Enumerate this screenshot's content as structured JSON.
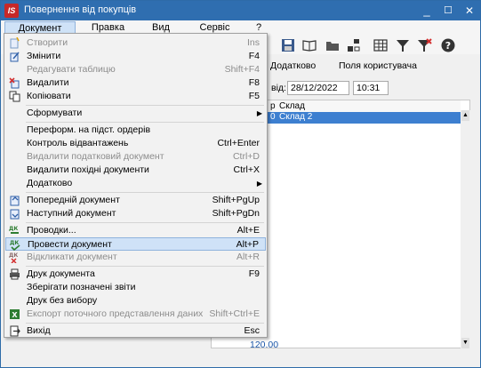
{
  "window": {
    "title": "Повернення від покупців"
  },
  "titlebar": {
    "minimize": "_",
    "maximize": "☐",
    "close": "✕"
  },
  "menubar": {
    "items": [
      "Документ",
      "Правка",
      "Вид",
      "Сервіс",
      "?"
    ]
  },
  "tabs": [
    "Додатково",
    "Поля користувача"
  ],
  "fields": {
    "date_label": "від:",
    "date": "28/12/2022",
    "time": "10:31"
  },
  "grid": {
    "header_col": "Склад",
    "header_prefix": "р",
    "row": {
      "prefix": "0",
      "warehouse": "Склад 2"
    },
    "total": "120.00"
  },
  "dropdown": {
    "items": [
      {
        "label": "Створити",
        "shortcut": "Ins",
        "disabled": true,
        "icon": "create-icon"
      },
      {
        "label": "Змінити",
        "shortcut": "F4",
        "disabled": false,
        "icon": "edit-icon"
      },
      {
        "label": "Редагувати таблицю",
        "shortcut": "Shift+F4",
        "disabled": true,
        "icon": ""
      },
      {
        "label": "Видалити",
        "shortcut": "F8",
        "disabled": false,
        "icon": "delete-icon"
      },
      {
        "label": "Копіювати",
        "shortcut": "F5",
        "disabled": false,
        "icon": "copy-icon"
      },
      {
        "label": "Сформувати",
        "shortcut": "",
        "disabled": false,
        "icon": "",
        "submenu": true
      },
      {
        "label": "Переформ. на підст. ордерів",
        "shortcut": "",
        "disabled": false,
        "icon": ""
      },
      {
        "label": "Контроль відвантажень",
        "shortcut": "Ctrl+Enter",
        "disabled": false,
        "icon": ""
      },
      {
        "label": "Видалити податковий документ",
        "shortcut": "Ctrl+D",
        "disabled": true,
        "icon": ""
      },
      {
        "label": "Видалити похідні документи",
        "shortcut": "Ctrl+X",
        "disabled": false,
        "icon": ""
      },
      {
        "label": "Додатково",
        "shortcut": "",
        "disabled": false,
        "icon": "",
        "submenu": true
      },
      {
        "label": "Попередній документ",
        "shortcut": "Shift+PgUp",
        "disabled": false,
        "icon": "prev-doc-icon"
      },
      {
        "label": "Наступний документ",
        "shortcut": "Shift+PgDn",
        "disabled": false,
        "icon": "next-doc-icon"
      },
      {
        "label": "Проводки...",
        "shortcut": "Alt+E",
        "disabled": false,
        "icon": "postings-icon"
      },
      {
        "label": "Провести документ",
        "shortcut": "Alt+P",
        "disabled": false,
        "icon": "post-doc-icon",
        "highlight": true
      },
      {
        "label": "Відкликати документ",
        "shortcut": "Alt+R",
        "disabled": true,
        "icon": "unpost-doc-icon"
      },
      {
        "label": "Друк документа",
        "shortcut": "F9",
        "disabled": false,
        "icon": "print-icon"
      },
      {
        "label": "Зберігати позначені звіти",
        "shortcut": "",
        "disabled": false,
        "icon": ""
      },
      {
        "label": "Друк без вибору",
        "shortcut": "",
        "disabled": false,
        "icon": ""
      },
      {
        "label": "Експорт поточного представлення даних",
        "shortcut": "Shift+Ctrl+E",
        "disabled": true,
        "icon": "excel-export-icon"
      },
      {
        "label": "Вихід",
        "shortcut": "Esc",
        "disabled": false,
        "icon": "exit-icon"
      }
    ]
  }
}
